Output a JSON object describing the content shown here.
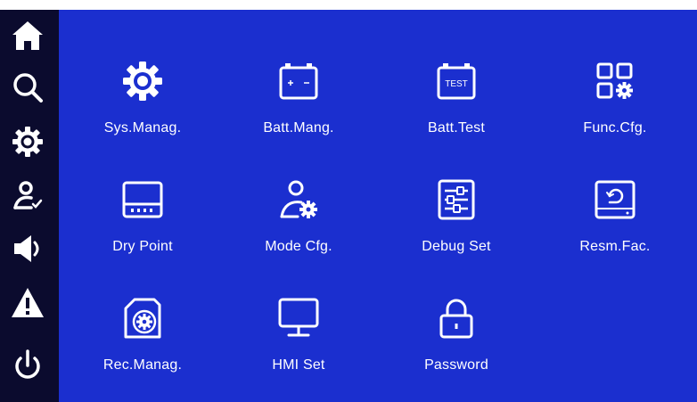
{
  "colors": {
    "sidebar_bg": "#0b0b2e",
    "main_bg": "#1b2fcf",
    "foreground": "#ffffff"
  },
  "sidebar": {
    "items": [
      {
        "icon": "home-icon"
      },
      {
        "icon": "search-icon"
      },
      {
        "icon": "gear-icon"
      },
      {
        "icon": "user-check-icon"
      },
      {
        "icon": "speaker-icon"
      },
      {
        "icon": "warning-icon"
      },
      {
        "icon": "power-icon"
      }
    ]
  },
  "menu": {
    "items": [
      {
        "label": "Sys.Manag.",
        "icon": "gear-icon"
      },
      {
        "label": "Batt.Mang.",
        "icon": "battery-icon"
      },
      {
        "label": "Batt.Test",
        "icon": "battery-test-icon",
        "icon_text": "TEST"
      },
      {
        "label": "Func.Cfg.",
        "icon": "function-grid-icon"
      },
      {
        "label": "Dry Point",
        "icon": "dry-point-icon"
      },
      {
        "label": "Mode Cfg.",
        "icon": "user-gear-icon"
      },
      {
        "label": "Debug Set",
        "icon": "sliders-icon"
      },
      {
        "label": "Resm.Fac.",
        "icon": "reset-device-icon"
      },
      {
        "label": "Rec.Manag.",
        "icon": "record-gear-icon"
      },
      {
        "label": "HMI Set",
        "icon": "monitor-icon"
      },
      {
        "label": "Password",
        "icon": "lock-icon"
      }
    ]
  }
}
